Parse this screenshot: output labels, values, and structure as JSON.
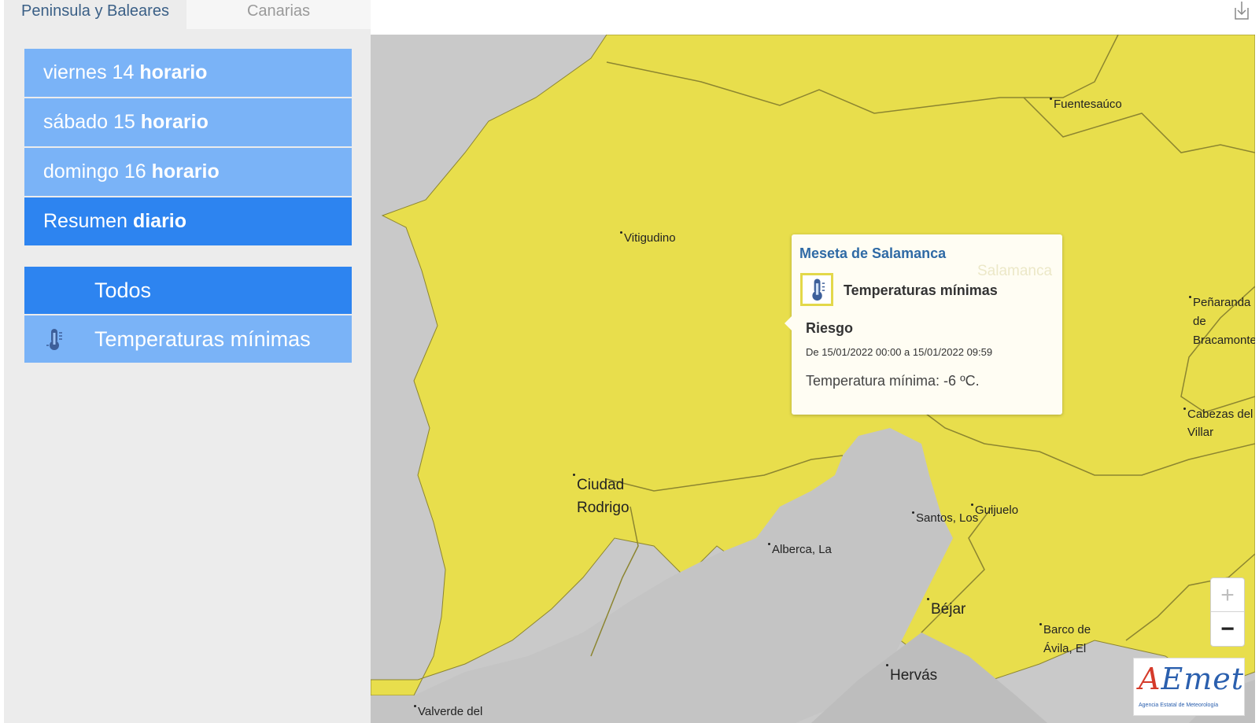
{
  "tabs": [
    {
      "label": "Peninsula y Baleares",
      "active": true
    },
    {
      "label": "Canarias",
      "active": false
    }
  ],
  "days": [
    {
      "name": "viernes 14",
      "bold": "horario",
      "selected": false
    },
    {
      "name": "sábado 15",
      "bold": "horario",
      "selected": false
    },
    {
      "name": "domingo 16",
      "bold": "horario",
      "selected": false
    },
    {
      "name": "Resumen",
      "bold": "diario",
      "selected": true
    }
  ],
  "filters": [
    {
      "label": "Todos",
      "icon": "none",
      "selected": true
    },
    {
      "label": "Temperaturas mínimas",
      "icon": "thermometer-icon",
      "selected": false
    }
  ],
  "places": {
    "fuentesauco": "Fuentesaúco",
    "vitigudino": "Vitigudino",
    "penaranda1": "Peñaranda",
    "penaranda2": "de",
    "penaranda3": "Bracamonte",
    "cabezas1": "Cabezas del",
    "cabezas2": "Villar",
    "ciudad1": "Ciudad",
    "ciudad2": "Rodrigo",
    "santos": "Santos, Los",
    "guijuelo": "Guijuelo",
    "alberca": "Alberca, La",
    "bejar": "Béjar",
    "barco1": "Barco de",
    "barco2": "Ávila, El",
    "hervas": "Hervás",
    "valverde": "Valverde del",
    "salamanca_ghost": "Salamanca"
  },
  "popup": {
    "zone": "Meseta de Salamanca",
    "phenomenon": "Temperaturas mínimas",
    "level": "Riesgo",
    "dates": "De 15/01/2022 00:00 a 15/01/2022 09:59",
    "description": "Temperatura mínima: -6 ºC."
  },
  "zoom": {
    "in": "+",
    "out": "−"
  },
  "logo": {
    "text_a": "A",
    "text_rest": "Emet",
    "subtitle": "Agencia Estatal de Meteorología"
  },
  "colors": {
    "warning_yellow": "#e8de4c",
    "button_light": "#7ab3f7",
    "button_selected": "#2d84f0",
    "relief_gray": "#c9c9c9"
  }
}
